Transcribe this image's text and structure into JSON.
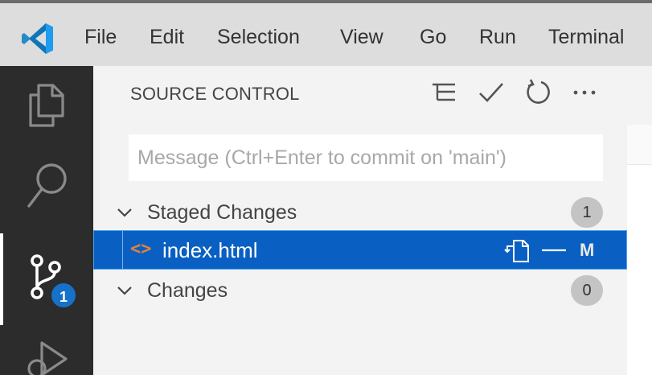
{
  "menubar": {
    "items": [
      "File",
      "Edit",
      "Selection",
      "View",
      "Go",
      "Run",
      "Terminal"
    ]
  },
  "activity_bar": {
    "items": [
      {
        "name": "explorer",
        "icon": "files-icon"
      },
      {
        "name": "search",
        "icon": "search-icon"
      },
      {
        "name": "source-control",
        "icon": "source-control-icon",
        "badge": "1"
      },
      {
        "name": "run-and-debug",
        "icon": "run-debug-icon"
      }
    ]
  },
  "scm": {
    "title": "SOURCE CONTROL",
    "actions": [
      "view-as-tree-icon",
      "commit-check-icon",
      "refresh-icon",
      "more-actions-icon"
    ],
    "message_placeholder": "Message (Ctrl+Enter to commit on 'main')",
    "message_value": "",
    "staged": {
      "label": "Staged Changes",
      "count": "1",
      "files": [
        {
          "icon": "<>",
          "name": "index.html",
          "status": "M"
        }
      ]
    },
    "changes": {
      "label": "Changes",
      "count": "0"
    }
  },
  "colors": {
    "menubar_bg": "#dddddd",
    "activity_bg": "#2c2c2c",
    "sidebar_bg": "#f3f3f3",
    "selection_bg": "#0a60c2",
    "badge_bg": "#1671c8",
    "html_icon": "#e0823d",
    "logo": "#1e88e5"
  }
}
